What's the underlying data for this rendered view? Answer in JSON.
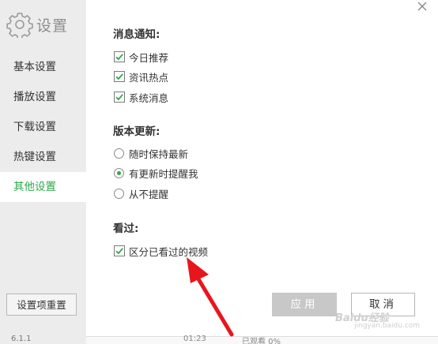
{
  "window": {
    "title": "设置"
  },
  "sidebar": {
    "items": [
      {
        "label": "基本设置",
        "active": false
      },
      {
        "label": "播放设置",
        "active": false
      },
      {
        "label": "下载设置",
        "active": false
      },
      {
        "label": "热键设置",
        "active": false
      },
      {
        "label": "其他设置",
        "active": true
      }
    ],
    "reset_label": "设置项重置",
    "footer_text": "6.1.1"
  },
  "sections": {
    "notifications": {
      "title": "消息通知:",
      "options": [
        {
          "label": "今日推荐",
          "checked": true
        },
        {
          "label": "资讯热点",
          "checked": true
        },
        {
          "label": "系统消息",
          "checked": true
        }
      ]
    },
    "updates": {
      "title": "版本更新:",
      "options": [
        {
          "label": "随时保持最新",
          "selected": false
        },
        {
          "label": "有更新时提醒我",
          "selected": true
        },
        {
          "label": "从不提醒",
          "selected": false
        }
      ]
    },
    "watched": {
      "title": "看过:",
      "options": [
        {
          "label": "区分已看过的视频",
          "checked": true
        }
      ]
    }
  },
  "actions": {
    "apply_label": "应用",
    "cancel_label": "取消"
  },
  "background_text": {
    "left": "01:23",
    "right": "已观看 0%"
  },
  "watermark": {
    "main": "Baidu经验",
    "sub": "jingyan.baidu.com"
  },
  "colors": {
    "accent": "#2fa84a",
    "arrow": "#e8161c",
    "sidebar_bg": "#ececec"
  }
}
